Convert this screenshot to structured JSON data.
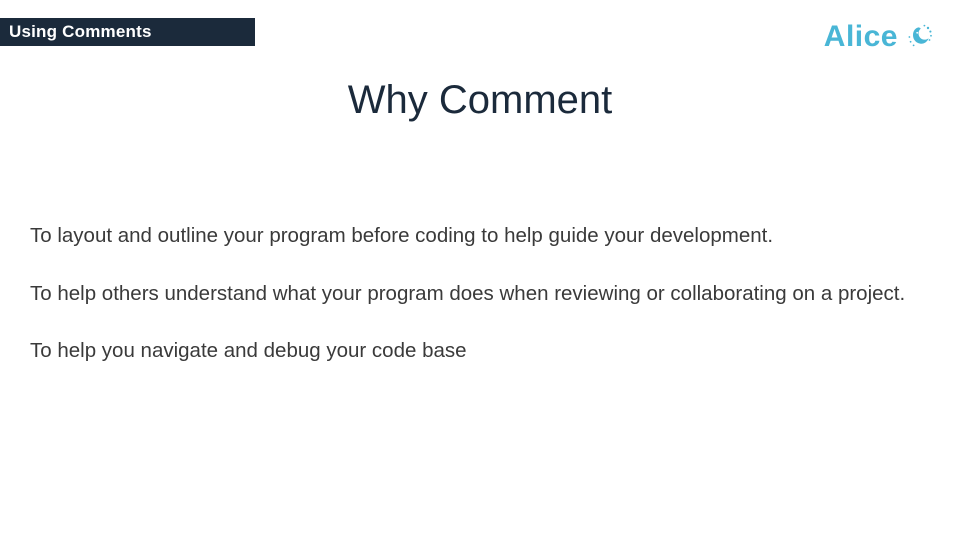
{
  "header": {
    "topic": "Using Comments",
    "brand": "Alice"
  },
  "slide": {
    "title": "Why Comment",
    "bullets": [
      "To layout and outline your program before coding to help guide your development.",
      "To help others understand what your program does when reviewing or collaborating on a project.",
      "To help you navigate and debug your code base"
    ]
  },
  "colors": {
    "dark_navy": "#1b2a3b",
    "brand_blue": "#49b6d6",
    "body_text": "#3a3a3a"
  }
}
